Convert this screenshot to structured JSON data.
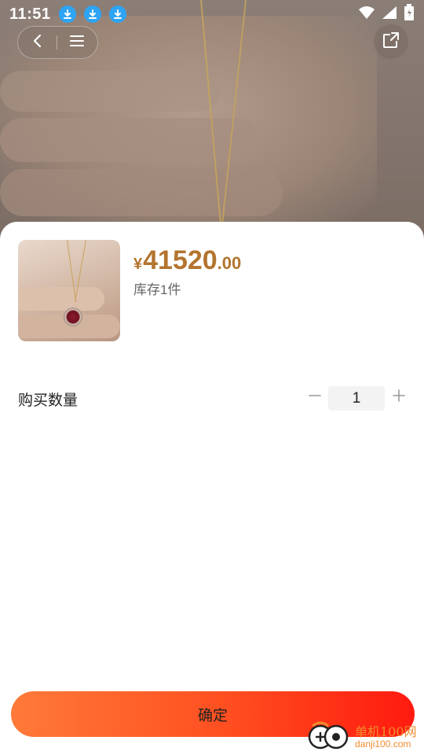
{
  "status_bar": {
    "time": "11:51",
    "download_icons": [
      "download-icon",
      "download-icon",
      "download-icon"
    ],
    "icons": [
      "wifi-icon",
      "signal-icon",
      "battery-icon"
    ]
  },
  "nav": {
    "back_icon": "chevron-left-icon",
    "menu_icon": "menu-icon",
    "share_icon": "share-icon"
  },
  "product": {
    "price_symbol": "¥",
    "price_integer": "41520",
    "price_decimal": ".00",
    "stock": "库存1件"
  },
  "quantity": {
    "label": "购买数量",
    "value": "1"
  },
  "confirm": {
    "label": "确定"
  },
  "watermark": {
    "line1": "单机100网",
    "line2": "danji100.com"
  },
  "colors": {
    "price": "#b3742f",
    "button_start": "#ff7a3a",
    "button_end": "#ff1a0f",
    "download_badge": "#2ea4f5"
  }
}
